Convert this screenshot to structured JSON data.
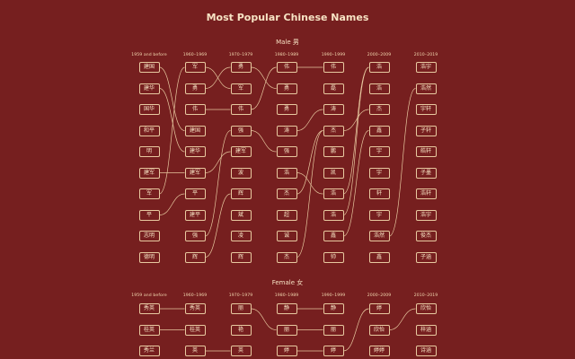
{
  "title": "Most Popular Chinese Names",
  "periods": [
    "1959 and before",
    "1960–1969",
    "1970–1979",
    "1980–1989",
    "1990–1999",
    "2000–2009",
    "2010–2019"
  ],
  "sections": [
    {
      "id": "male",
      "title": "Male 男",
      "columns": [
        [
          "建国",
          "建华",
          "国华",
          "和平",
          "明",
          "建军",
          "军",
          "平",
          "志明",
          "德明"
        ],
        [
          "军",
          "勇",
          "伟",
          "建国",
          "建华",
          "建军",
          "平",
          "建平",
          "强",
          "辉"
        ],
        [
          "勇",
          "军",
          "伟",
          "强",
          "建军",
          "波",
          "辉",
          "斌",
          "凌",
          "辉"
        ],
        [
          "伟",
          "勇",
          "勇",
          "涛",
          "强",
          "浩",
          "杰",
          "超",
          "诚",
          "杰"
        ],
        [
          "伟",
          "磊",
          "涛",
          "杰",
          "鹏",
          "凯",
          "浩",
          "浩",
          "鑫",
          "帅"
        ],
        [
          "浩",
          "浩",
          "杰",
          "鑫",
          "宇",
          "宇",
          "轩",
          "宇",
          "浩然",
          "鑫"
        ],
        [
          "浩宇",
          "浩然",
          "宇轩",
          "子轩",
          "皓轩",
          "子墨",
          "浩轩",
          "浩宇",
          "俊杰",
          "子涵"
        ]
      ]
    },
    {
      "id": "female",
      "title": "Female 女",
      "columns": [
        [
          "秀英",
          "桂英",
          "秀兰"
        ],
        [
          "秀英",
          "桂英",
          "英"
        ],
        [
          "丽",
          "艳",
          "英"
        ],
        [
          "静",
          "丽",
          "婷"
        ],
        [
          "静",
          "丽",
          "婷"
        ],
        [
          "婷",
          "欣怡",
          "婷婷"
        ],
        [
          "欣怡",
          "梓涵",
          "诗涵"
        ]
      ]
    }
  ]
}
